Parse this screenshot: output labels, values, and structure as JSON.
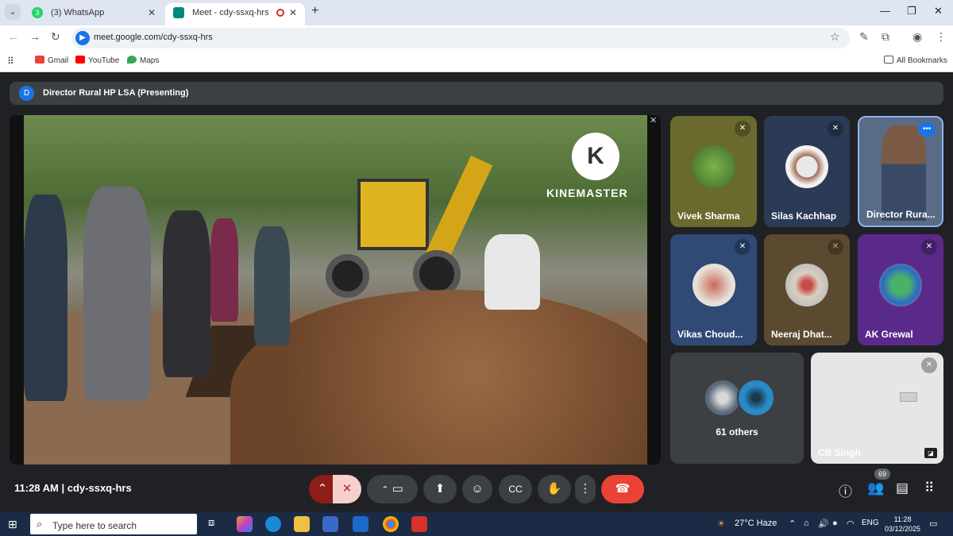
{
  "browser": {
    "tabs": [
      {
        "label": "(3) WhatsApp",
        "active": false
      },
      {
        "label": "Meet - cdy-ssxq-hrs",
        "active": true
      }
    ],
    "new_tab": "+",
    "url": "meet.google.com/cdy-ssxq-hrs",
    "bookmarks": [
      "Gmail",
      "YouTube",
      "Maps"
    ],
    "all_bookmarks": "All Bookmarks",
    "whatsapp_badge": "3"
  },
  "meeting": {
    "presenter_initial": "D",
    "presenting_label": "Director Rural HP LSA (Presenting)",
    "video_watermark": "KINEMASTER",
    "watermark_logo": "K",
    "participants": [
      {
        "name": "Vivek Sharma",
        "bg": "#6b6a2e"
      },
      {
        "name": "Silas Kachhap",
        "bg": "#2b3a55"
      },
      {
        "name": "Director Rura...",
        "bg": "#5a6b85"
      },
      {
        "name": "Vikas Choud...",
        "bg": "#2e4a75"
      },
      {
        "name": "Neeraj Dhat...",
        "bg": "#5a4a30"
      },
      {
        "name": "AK Grewal",
        "bg": "#5a2a8a"
      }
    ],
    "others_label": "61 others",
    "cb_name": "CB Singh",
    "clock": "11:28 AM",
    "meeting_code": "cdy-ssxq-hrs",
    "participant_count": "69",
    "colors": {
      "end_call": "#ea4335",
      "accent": "#1a73e8"
    }
  },
  "taskbar": {
    "search_placeholder": "Type here to search",
    "weather": "27°C  Haze",
    "lang": "ENG",
    "time": "11:28",
    "date": "03/12/2025"
  }
}
